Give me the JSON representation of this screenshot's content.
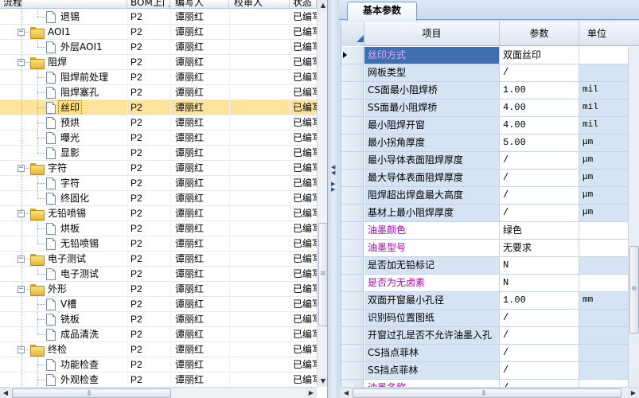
{
  "left_grid": {
    "columns": [
      "流程",
      "BOM上门",
      "编写人",
      "校审人",
      "状态"
    ],
    "rows": [
      {
        "label": "退锡",
        "bom": "P2",
        "writer": "谭丽红",
        "status": "已编写",
        "kind": "doc",
        "level": 2,
        "last": true
      },
      {
        "label": "AOI1",
        "bom": "P2",
        "writer": "谭丽红",
        "status": "已编写",
        "kind": "folder",
        "level": 1,
        "toggle": "−"
      },
      {
        "label": "外层AOI1",
        "bom": "P2",
        "writer": "谭丽红",
        "status": "已编写",
        "kind": "doc",
        "level": 2,
        "last": true
      },
      {
        "label": "阻焊",
        "bom": "P2",
        "writer": "谭丽红",
        "status": "已编写",
        "kind": "folder",
        "level": 1,
        "toggle": "−"
      },
      {
        "label": "阻焊前处理",
        "bom": "P2",
        "writer": "谭丽红",
        "status": "已编写",
        "kind": "doc",
        "level": 2
      },
      {
        "label": "阻焊塞孔",
        "bom": "P2",
        "writer": "谭丽红",
        "status": "已编写",
        "kind": "doc",
        "level": 2
      },
      {
        "label": "丝印",
        "bom": "P2",
        "writer": "谭丽红",
        "status": "已编写",
        "kind": "doc",
        "level": 2,
        "selected": true
      },
      {
        "label": "预烘",
        "bom": "P2",
        "writer": "谭丽红",
        "status": "已编写",
        "kind": "doc",
        "level": 2
      },
      {
        "label": "曝光",
        "bom": "P2",
        "writer": "谭丽红",
        "status": "已编写",
        "kind": "doc",
        "level": 2
      },
      {
        "label": "显影",
        "bom": "P2",
        "writer": "谭丽红",
        "status": "已编写",
        "kind": "doc",
        "level": 2,
        "last": true
      },
      {
        "label": "字符",
        "bom": "P2",
        "writer": "谭丽红",
        "status": "已编写",
        "kind": "folder",
        "level": 1,
        "toggle": "−"
      },
      {
        "label": "字符",
        "bom": "P2",
        "writer": "谭丽红",
        "status": "已编写",
        "kind": "doc",
        "level": 2
      },
      {
        "label": "终固化",
        "bom": "P2",
        "writer": "谭丽红",
        "status": "已编写",
        "kind": "doc",
        "level": 2,
        "last": true
      },
      {
        "label": "无铅喷锡",
        "bom": "P2",
        "writer": "谭丽红",
        "status": "已编写",
        "kind": "folder",
        "level": 1,
        "toggle": "−"
      },
      {
        "label": "烘板",
        "bom": "P2",
        "writer": "谭丽红",
        "status": "已编写",
        "kind": "doc",
        "level": 2
      },
      {
        "label": "无铅喷锡",
        "bom": "P2",
        "writer": "谭丽红",
        "status": "已编写",
        "kind": "doc",
        "level": 2,
        "last": true
      },
      {
        "label": "电子测试",
        "bom": "P2",
        "writer": "谭丽红",
        "status": "已编写",
        "kind": "folder",
        "level": 1,
        "toggle": "−"
      },
      {
        "label": "电子测试",
        "bom": "P2",
        "writer": "谭丽红",
        "status": "已编写",
        "kind": "doc",
        "level": 2,
        "last": true
      },
      {
        "label": "外形",
        "bom": "P2",
        "writer": "谭丽红",
        "status": "已编写",
        "kind": "folder",
        "level": 1,
        "toggle": "−"
      },
      {
        "label": "V槽",
        "bom": "P2",
        "writer": "谭丽红",
        "status": "已编写",
        "kind": "doc",
        "level": 2
      },
      {
        "label": "铣板",
        "bom": "P2",
        "writer": "谭丽红",
        "status": "已编写",
        "kind": "doc",
        "level": 2
      },
      {
        "label": "成品清洗",
        "bom": "P2",
        "writer": "谭丽红",
        "status": "已编写",
        "kind": "doc",
        "level": 2,
        "last": true
      },
      {
        "label": "终检",
        "bom": "P2",
        "writer": "谭丽红",
        "status": "已编写",
        "kind": "folder",
        "level": 1,
        "toggle": "−"
      },
      {
        "label": "功能检查",
        "bom": "P2",
        "writer": "谭丽红",
        "status": "已编写",
        "kind": "doc",
        "level": 2
      },
      {
        "label": "外观检查",
        "bom": "P2",
        "writer": "谭丽红",
        "status": "已编写",
        "kind": "doc",
        "level": 2
      }
    ]
  },
  "right_panel": {
    "tab_label": "基本参数",
    "columns": [
      "项目",
      "参数",
      "单位"
    ],
    "rows": [
      {
        "name": "丝印方式",
        "value": "双面丝印",
        "unit": "",
        "style": "selected",
        "current": true
      },
      {
        "name": "网板类型",
        "value": "/",
        "unit": "",
        "style": "disabled"
      },
      {
        "name": "CS面最小阻焊桥",
        "value": "1.00",
        "unit": "mil",
        "style": "disabled"
      },
      {
        "name": "SS面最小阻焊桥",
        "value": "4.00",
        "unit": "mil",
        "style": "disabled"
      },
      {
        "name": "最小阻焊开窗",
        "value": "4.00",
        "unit": "mil",
        "style": "disabled"
      },
      {
        "name": "最小拐角厚度",
        "value": "5.00",
        "unit": "μm",
        "style": "disabled"
      },
      {
        "name": "最小导体表面阻焊厚度",
        "value": "/",
        "unit": "μm",
        "style": "disabled"
      },
      {
        "name": "最大导体表面阻焊厚度",
        "value": "/",
        "unit": "μm",
        "style": "disabled"
      },
      {
        "name": "阻焊超出焊盘最大高度",
        "value": "/",
        "unit": "μm",
        "style": "disabled"
      },
      {
        "name": "基材上最小阻焊厚度",
        "value": "/",
        "unit": "μm",
        "style": "disabled"
      },
      {
        "name": "油墨颜色",
        "value": "绿色",
        "unit": "",
        "style": "magenta"
      },
      {
        "name": "油墨型号",
        "value": "无要求",
        "unit": "",
        "style": "magenta"
      },
      {
        "name": "是否加无铅标记",
        "value": "N",
        "unit": "",
        "style": "disabled"
      },
      {
        "name": "是否为无卤素",
        "value": "N",
        "unit": "",
        "style": "magenta"
      },
      {
        "name": "双面开窗最小孔径",
        "value": "1.00",
        "unit": "mm",
        "style": "disabled"
      },
      {
        "name": "识别码位置图纸",
        "value": "/",
        "unit": "",
        "style": "disabled"
      },
      {
        "name": "开窗过孔是否不允许油墨入孔",
        "value": "/",
        "unit": "",
        "style": "disabled"
      },
      {
        "name": "CS挡点菲林",
        "value": "/",
        "unit": "",
        "style": "disabled"
      },
      {
        "name": "SS挡点菲林",
        "value": "/",
        "unit": "",
        "style": "disabled"
      },
      {
        "name": "油墨名称",
        "value": "/",
        "unit": "",
        "style": "magenta"
      }
    ]
  },
  "icons": {
    "folder": "folder-icon",
    "document": "document-icon",
    "row_indicator": "current-row-arrow-icon",
    "collapse": "collapse-minus-icon"
  },
  "colors": {
    "selected_tree_row": "#fde49a",
    "grid_label_disabled": "#d6e3f2",
    "grid_label_magenta": "#b300b3",
    "grid_selected_cell": "#3f6fb0",
    "pane_background": "#dfe9f5"
  }
}
